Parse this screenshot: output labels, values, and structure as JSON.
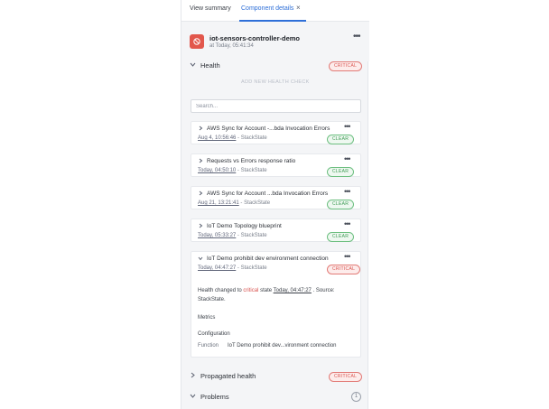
{
  "tabs": {
    "view_summary": "View summary",
    "component_details": "Component details",
    "close": "×"
  },
  "component": {
    "name": "iot-sensors-controller-demo",
    "time": "at Today, 05:41:34",
    "more": "•••"
  },
  "health": {
    "title": "Health",
    "status": "CRITICAL",
    "add_check": "ADD NEW HEALTH CHECK",
    "search_placeholder": "Search..."
  },
  "checks": [
    {
      "title": "AWS Sync for Account -...bda Invocation Errors",
      "timestamp": "Aug 4, 10:56:46",
      "source": "StackState",
      "status": "CLEAR"
    },
    {
      "title": "Requests vs Errors response ratio",
      "timestamp": "Today, 04:50:10",
      "source": "StackState",
      "status": "CLEAR"
    },
    {
      "title": "AWS Sync for Account ...bda Invocation Errors",
      "timestamp": "Aug 21, 13:21:41",
      "source": "StackState",
      "status": "CLEAR"
    },
    {
      "title": "IoT Demo Topology blueprint",
      "timestamp": "Today, 05:33:27",
      "source": "StackState",
      "status": "CLEAR"
    },
    {
      "title": "IoT Demo prohibit dev environment connection",
      "timestamp": "Today, 04:47:27",
      "source": "StackState",
      "status": "CRITICAL"
    }
  ],
  "expanded": {
    "line1_pre": "Health changed to",
    "line1_state": "critical",
    "line1_mid": "state",
    "line1_ts": "Today, 04:47:27",
    "line1_post": ". Source:",
    "line2": "StackState.",
    "metrics": "Metrics",
    "configuration": "Configuration",
    "function_label": "Function",
    "function_value": "IoT Demo prohibit dev...vironment connection"
  },
  "propagated": {
    "title": "Propagated health",
    "status": "CRITICAL"
  },
  "problems": {
    "title": "Problems",
    "count": "1"
  },
  "icons": {
    "chevron_right": "›",
    "chevron_down": "⌄"
  },
  "colors": {
    "accent": "#2e6fd8",
    "critical": "#d9534f",
    "clear": "#3c9a52"
  }
}
